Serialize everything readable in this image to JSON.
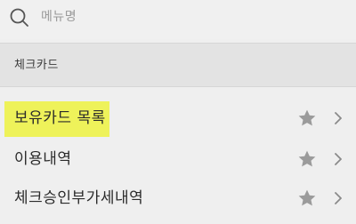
{
  "search": {
    "placeholder": "메뉴명",
    "icon": "search-icon"
  },
  "section": {
    "title": "체크카드"
  },
  "menu": {
    "items": [
      {
        "label": "보유카드 목록",
        "highlighted": true,
        "highlight_color": "#eef25a",
        "favorite_icon": "star-icon",
        "arrow_icon": "chevron-right-icon"
      },
      {
        "label": "이용내역",
        "highlighted": false,
        "favorite_icon": "star-icon",
        "arrow_icon": "chevron-right-icon"
      },
      {
        "label": "체크승인부가세내역",
        "highlighted": false,
        "favorite_icon": "star-icon",
        "arrow_icon": "chevron-right-icon"
      }
    ]
  },
  "colors": {
    "background": "#efefef",
    "section_background": "#e3e3e3",
    "star": "#9b9b9b",
    "chevron": "#8a8a8a"
  }
}
